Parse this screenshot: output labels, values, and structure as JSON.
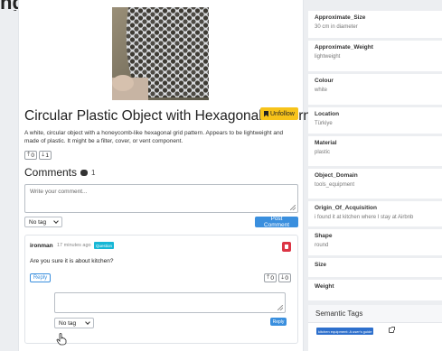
{
  "page": {
    "title_fragment": "ng"
  },
  "object": {
    "title": "Circular Plastic Object with Hexagonal Pattern",
    "follow_label": "Unfollow",
    "description": "A white, circular object with a honeycomb-like hexagonal grid pattern. Appears to be lightweight and made of plastic. It might be a filter, cover, or vent component.",
    "votes": {
      "up": "0",
      "down": "1"
    }
  },
  "comments": {
    "heading": "Comments",
    "count": "1",
    "input_placeholder": "Write your comment...",
    "tag_select": "No tag",
    "post_label": "Post Comment",
    "items": [
      {
        "author": "ironman",
        "time_ago": "17 minutes ago",
        "badge": "Question",
        "text": "Are you sure it is about kitchen?",
        "reply_label": "Reply",
        "votes": {
          "up": "0",
          "down": "0"
        },
        "reply_tag_select": "No tag",
        "reply_submit_label": "Reply"
      }
    ]
  },
  "attributes": [
    {
      "label": "Approximate_Size",
      "value": "30 cm in diameter"
    },
    {
      "label": "Approximate_Weight",
      "value": "lightweight"
    },
    {
      "label": "Colour",
      "value": "white"
    },
    {
      "label": "Location",
      "value": "Türkiye"
    },
    {
      "label": "Material",
      "value": "plastic"
    },
    {
      "label": "Object_Domain",
      "value": "tools_equipment"
    },
    {
      "label": "Origin_Of_Acquisition",
      "value": "i found it at kitchen where I stay at Airbnb"
    },
    {
      "label": "Shape",
      "value": "round"
    },
    {
      "label": "Size",
      "value": ""
    },
    {
      "label": "Weight",
      "value": ""
    }
  ],
  "semantic_tags": {
    "heading": "Semantic Tags",
    "tags": [
      "kitchen equipment: A user's guide"
    ]
  },
  "colors": {
    "accent": "#3a8fde",
    "follow": "#f7c31a",
    "badge": "#17b7d6",
    "danger": "#dc3545",
    "tag": "#2d6fcc"
  }
}
